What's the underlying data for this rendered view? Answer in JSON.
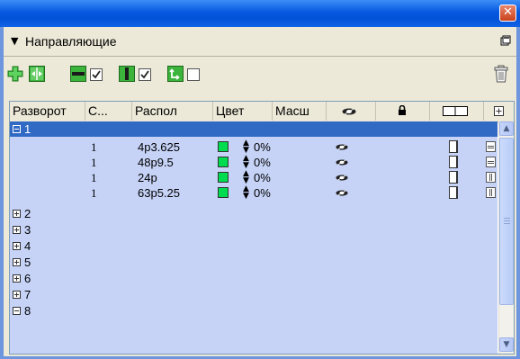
{
  "window": {
    "close_glyph": "✕"
  },
  "panel": {
    "tab_title": "Направляющие",
    "tab_arrow": "▼"
  },
  "toolbar": {
    "icons": [
      "add-guide-icon",
      "center-guides-icon",
      "horizontal-guide-icon",
      "horizontal-checkbox",
      "vertical-guide-icon",
      "vertical-checkbox",
      "snap-guide-icon",
      "snap-checkbox",
      "trash-icon"
    ],
    "horizontal_checked": true,
    "vertical_checked": true,
    "snap_checked": false
  },
  "columns": {
    "spread": "Разворот",
    "page": "С...",
    "location": "Распол",
    "color": "Цвет",
    "scale": "Масш",
    "visibility_icon": "eye-icon",
    "lock_icon": "lock-icon",
    "pages_icon": "page-icon",
    "add_icon": "plus-icon"
  },
  "colors": {
    "guide_green": "#00dc50",
    "selection": "#316ac5",
    "row_bg": "#c6d3f7"
  },
  "spreads": [
    {
      "label": "1",
      "expanded": true,
      "selected": true
    },
    {
      "label": "2",
      "expanded": false
    },
    {
      "label": "3",
      "expanded": false
    },
    {
      "label": "4",
      "expanded": false
    },
    {
      "label": "5",
      "expanded": false
    },
    {
      "label": "6",
      "expanded": false
    },
    {
      "label": "7",
      "expanded": false
    },
    {
      "label": "8",
      "expanded": true
    }
  ],
  "guides": [
    {
      "page": "1",
      "location": "4p3.625",
      "scale": "0%",
      "orientation": "horizontal"
    },
    {
      "page": "1",
      "location": "48p9.5",
      "scale": "0%",
      "orientation": "horizontal"
    },
    {
      "page": "1",
      "location": "24p",
      "scale": "0%",
      "orientation": "vertical"
    },
    {
      "page": "1",
      "location": "63p5.25",
      "scale": "0%",
      "orientation": "vertical"
    }
  ]
}
